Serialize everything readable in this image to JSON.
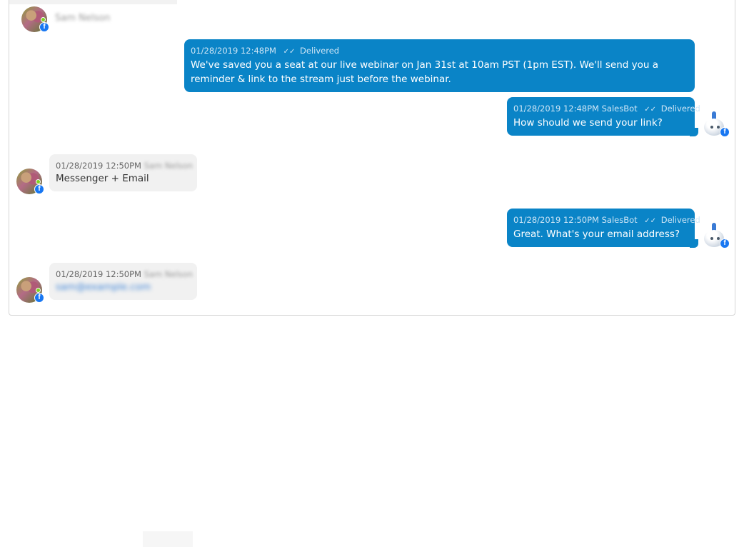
{
  "contact": {
    "name": "Sam Nelson"
  },
  "messages": [
    {
      "timestamp": "01/28/2019 12:48PM",
      "sender": "",
      "status": "Delivered",
      "check": "✓✓",
      "text": "We've saved you a seat at our live webinar on Jan 31st at 10am PST (1pm EST). We'll send you a reminder & link to the stream just before the webinar."
    },
    {
      "timestamp": "01/28/2019 12:48PM",
      "sender": "SalesBot",
      "status": "Delivered",
      "check": "✓✓",
      "text": "How should we send your link?"
    },
    {
      "timestamp": "01/28/2019 12:50PM",
      "sender": "Sam Nelson",
      "text": "Messenger + Email"
    },
    {
      "timestamp": "01/28/2019 12:50PM",
      "sender": "SalesBot",
      "status": "Delivered",
      "check": "✓✓",
      "text": "Great. What's your email address?"
    },
    {
      "timestamp": "01/28/2019 12:50PM",
      "sender": "Sam Nelson",
      "text": "sam@example.com"
    }
  ],
  "icons": {
    "facebook": "f",
    "bot": "robot-icon",
    "check": "double-check-icon"
  },
  "colors": {
    "outgoing": "#0a84c7",
    "incoming": "#f1f1f1",
    "facebook": "#1877f2"
  }
}
